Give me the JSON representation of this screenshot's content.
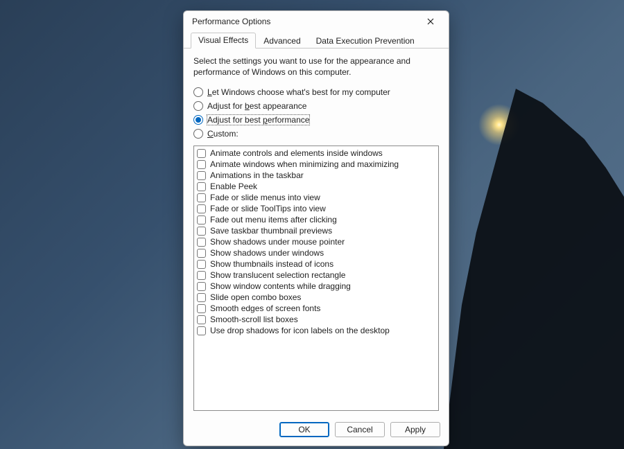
{
  "window": {
    "title": "Performance Options"
  },
  "tabs": [
    {
      "label": "Visual Effects",
      "active": true
    },
    {
      "label": "Advanced",
      "active": false
    },
    {
      "label": "Data Execution Prevention",
      "active": false
    }
  ],
  "intro": "Select the settings you want to use for the appearance and performance of Windows on this computer.",
  "radio_options": [
    {
      "id": "let-windows",
      "pre": "",
      "mn": "L",
      "post": "et Windows choose what's best for my computer",
      "selected": false
    },
    {
      "id": "best-appearance",
      "pre": "Adjust for ",
      "mn": "b",
      "post": "est appearance",
      "selected": false
    },
    {
      "id": "best-performance",
      "pre": "Adjust for best ",
      "mn": "p",
      "post": "erformance",
      "selected": true
    },
    {
      "id": "custom",
      "pre": "",
      "mn": "C",
      "post": "ustom:",
      "selected": false
    }
  ],
  "checkbox_items": [
    "Animate controls and elements inside windows",
    "Animate windows when minimizing and maximizing",
    "Animations in the taskbar",
    "Enable Peek",
    "Fade or slide menus into view",
    "Fade or slide ToolTips into view",
    "Fade out menu items after clicking",
    "Save taskbar thumbnail previews",
    "Show shadows under mouse pointer",
    "Show shadows under windows",
    "Show thumbnails instead of icons",
    "Show translucent selection rectangle",
    "Show window contents while dragging",
    "Slide open combo boxes",
    "Smooth edges of screen fonts",
    "Smooth-scroll list boxes",
    "Use drop shadows for icon labels on the desktop"
  ],
  "buttons": {
    "ok": "OK",
    "cancel": "Cancel",
    "apply": "Apply"
  }
}
